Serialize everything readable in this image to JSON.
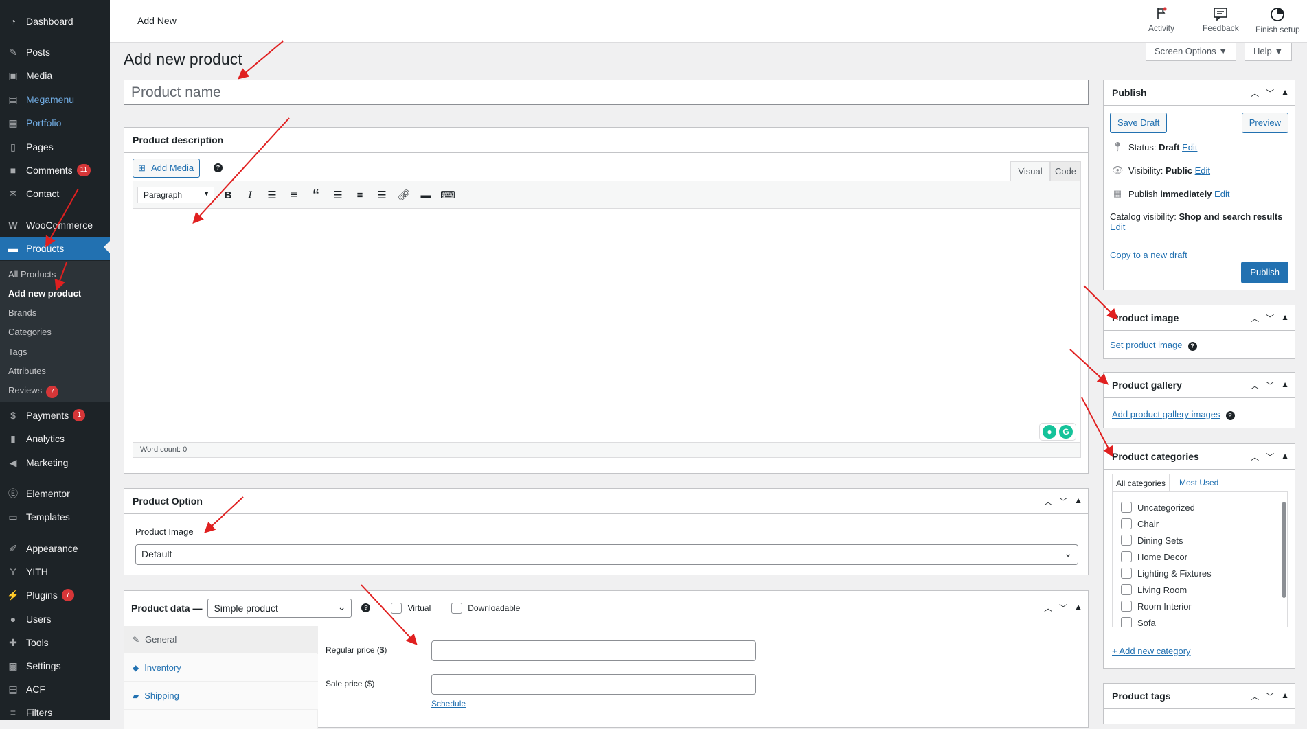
{
  "sidebar": {
    "items": [
      {
        "label": "Dashboard",
        "icon": "dashboard-icon"
      },
      {
        "label": "Posts",
        "icon": "pin-icon"
      },
      {
        "label": "Media",
        "icon": "media-icon"
      },
      {
        "label": "Megamenu",
        "icon": "menu-icon"
      },
      {
        "label": "Portfolio",
        "icon": "portfolio-icon"
      },
      {
        "label": "Pages",
        "icon": "pages-icon"
      },
      {
        "label": "Comments",
        "icon": "comments-icon",
        "badge": "11"
      },
      {
        "label": "Contact",
        "icon": "mail-icon"
      },
      {
        "label": "WooCommerce",
        "icon": "woo-icon"
      },
      {
        "label": "Products",
        "icon": "archive-icon"
      },
      {
        "label": "Payments",
        "icon": "payments-icon",
        "badge": "1"
      },
      {
        "label": "Analytics",
        "icon": "chart-icon"
      },
      {
        "label": "Marketing",
        "icon": "megaphone-icon"
      },
      {
        "label": "Elementor",
        "icon": "elementor-icon"
      },
      {
        "label": "Templates",
        "icon": "folder-icon"
      },
      {
        "label": "Appearance",
        "icon": "brush-icon"
      },
      {
        "label": "YITH",
        "icon": "yith-icon"
      },
      {
        "label": "Plugins",
        "icon": "plugin-icon",
        "badge": "7"
      },
      {
        "label": "Users",
        "icon": "user-icon"
      },
      {
        "label": "Tools",
        "icon": "wrench-icon"
      },
      {
        "label": "Settings",
        "icon": "settings-icon"
      },
      {
        "label": "ACF",
        "icon": "acf-icon"
      },
      {
        "label": "Filters",
        "icon": "filter-icon"
      }
    ],
    "submenu": [
      {
        "label": "All Products"
      },
      {
        "label": "Add new product"
      },
      {
        "label": "Brands"
      },
      {
        "label": "Categories"
      },
      {
        "label": "Tags"
      },
      {
        "label": "Attributes"
      },
      {
        "label": "Reviews",
        "badge": "7"
      }
    ]
  },
  "topbar": {
    "title": "Add New",
    "activity": "Activity",
    "feedback": "Feedback",
    "finish_setup": "Finish setup",
    "screen_options": "Screen Options ▼",
    "help": "Help ▼"
  },
  "page": {
    "title": "Add new product",
    "name_placeholder": "Product name"
  },
  "description": {
    "heading": "Product description",
    "add_media": "Add Media",
    "tab_visual": "Visual",
    "tab_code": "Code",
    "format": "Paragraph",
    "word_count": "Word count: 0"
  },
  "product_option": {
    "heading": "Product Option",
    "image_label": "Product Image",
    "image_value": "Default"
  },
  "product_data": {
    "heading": "Product data —",
    "type": "Simple product",
    "virtual": "Virtual",
    "downloadable": "Downloadable",
    "tabs": [
      "General",
      "Inventory",
      "Shipping"
    ],
    "regular_price": "Regular price ($)",
    "sale_price": "Sale price ($)",
    "schedule": "Schedule"
  },
  "publish": {
    "heading": "Publish",
    "save_draft": "Save Draft",
    "preview": "Preview",
    "status_label": "Status:",
    "status_value": "Draft",
    "visibility_label": "Visibility:",
    "visibility_value": "Public",
    "publish_label": "Publish",
    "publish_value": "immediately",
    "edit": "Edit",
    "catalog_label": "Catalog visibility:",
    "catalog_value": "Shop and search results",
    "copy_draft": "Copy to a new draft",
    "publish_btn": "Publish"
  },
  "product_image": {
    "heading": "Product image",
    "link": "Set product image"
  },
  "product_gallery": {
    "heading": "Product gallery",
    "link": "Add product gallery images"
  },
  "product_categories": {
    "heading": "Product categories",
    "tab_all": "All categories",
    "tab_used": "Most Used",
    "items": [
      "Uncategorized",
      "Chair",
      "Dining Sets",
      "Home Decor",
      "Lighting & Fixtures",
      "Living Room",
      "Room Interior",
      "Sofa"
    ],
    "add_new": "+ Add new category"
  },
  "product_tags": {
    "heading": "Product tags"
  },
  "colors": {
    "accent": "#2271b1",
    "sidebar": "#1d2327",
    "active": "#2271b1",
    "annotation": "#e02020"
  }
}
